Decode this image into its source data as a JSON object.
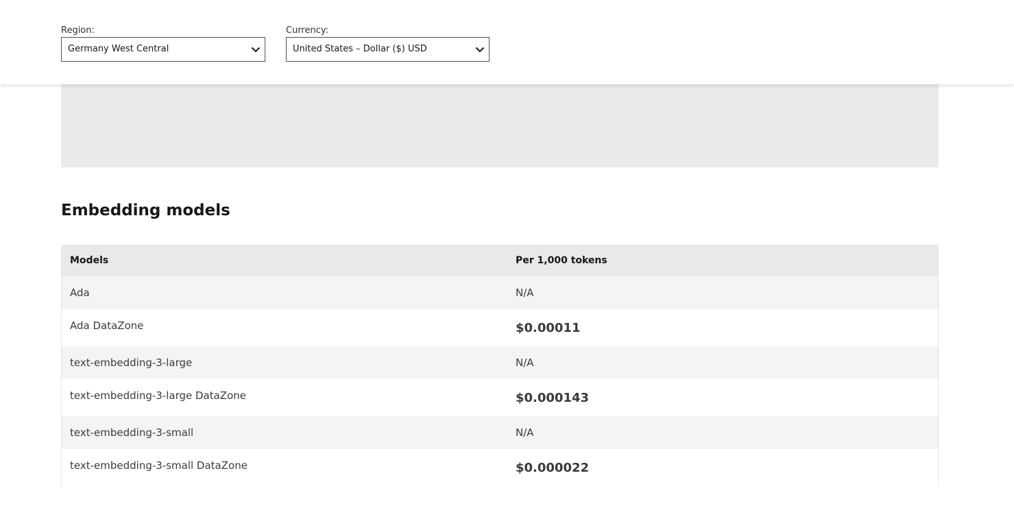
{
  "filters": {
    "region": {
      "label": "Region:",
      "value": "Germany West Central"
    },
    "currency": {
      "label": "Currency:",
      "value": "United States – Dollar ($) USD"
    }
  },
  "icons": {
    "dropdown": "chevron-down-icon"
  },
  "colors": {
    "banner_bg": "#e9eaeb",
    "table_header_bg": "#e8e9ea",
    "row_alt_bg": "#f3f4f5"
  },
  "section": {
    "title": "Embedding models"
  },
  "table": {
    "headers": [
      "Models",
      "Per 1,000 tokens"
    ],
    "rows": [
      {
        "model": "Ada",
        "price": "N/A"
      },
      {
        "model": "Ada DataZone",
        "price": "$0.00011"
      },
      {
        "model": "text-embedding-3-large",
        "price": "N/A"
      },
      {
        "model": "text-embedding-3-large DataZone",
        "price": "$0.000143"
      },
      {
        "model": "text-embedding-3-small",
        "price": "N/A"
      },
      {
        "model": "text-embedding-3-small DataZone",
        "price": "$0.000022"
      }
    ]
  }
}
